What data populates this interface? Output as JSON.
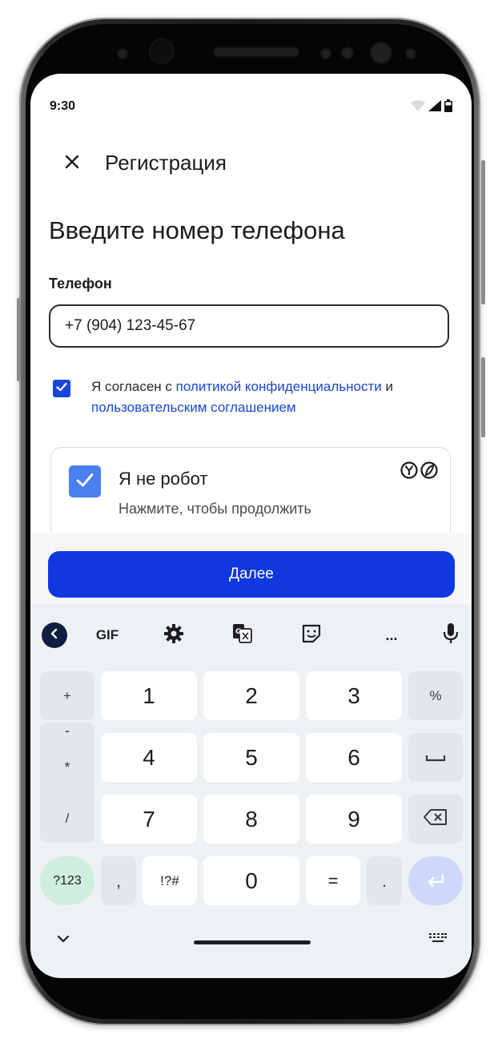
{
  "status_bar": {
    "time": "9:30"
  },
  "appbar": {
    "title": "Регистрация",
    "close_icon": "close-icon"
  },
  "heading": "Введите номер телефона",
  "phone_field": {
    "label": "Телефон",
    "value": "+7 (904) 123-45-67"
  },
  "consent": {
    "checked": true,
    "prefix": "Я согласен с ",
    "privacy_link": "политикой конфиденциальности",
    "middle": " и ",
    "terms_link": "пользовательским соглашением"
  },
  "captcha": {
    "checked": true,
    "title": "Я не робот",
    "subtitle": "Нажмите, чтобы продолжить"
  },
  "next_button": {
    "label": "Далее"
  },
  "keyboard": {
    "toolbar": {
      "gif_label": "GIF",
      "more_label": "..."
    },
    "side_symbols": [
      "+",
      "-",
      "*",
      "/"
    ],
    "digits": [
      "1",
      "2",
      "3",
      "4",
      "5",
      "6",
      "7",
      "8",
      "9",
      "0"
    ],
    "percent": "%",
    "mode_key": "?123",
    "comma": ",",
    "symbols_key": "!?#",
    "equals": "=",
    "dot": "."
  },
  "colors": {
    "accent": "#1038e0",
    "link": "#1a46d6",
    "captcha_check": "#4a7ff0",
    "keyboard_bg": "#eef1f4",
    "mode_key": "#cfeedd",
    "enter_key": "#cfd8fb"
  }
}
